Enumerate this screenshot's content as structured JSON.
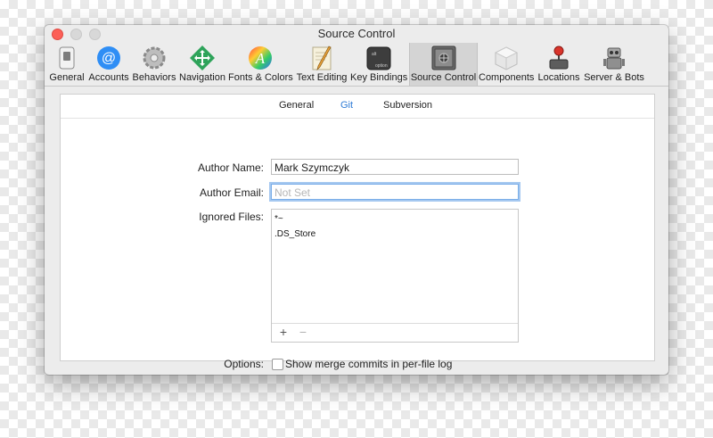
{
  "window": {
    "title": "Source Control"
  },
  "toolbar": {
    "items": [
      {
        "label": "General",
        "icon": "switch-icon"
      },
      {
        "label": "Accounts",
        "icon": "at-icon"
      },
      {
        "label": "Behaviors",
        "icon": "gear-icon"
      },
      {
        "label": "Navigation",
        "icon": "arrows-icon"
      },
      {
        "label": "Fonts & Colors",
        "icon": "font-color-icon"
      },
      {
        "label": "Text Editing",
        "icon": "pencil-paper-icon"
      },
      {
        "label": "Key Bindings",
        "icon": "keyboard-icon"
      },
      {
        "label": "Source Control",
        "icon": "safe-icon",
        "selected": true
      },
      {
        "label": "Components",
        "icon": "box-icon"
      },
      {
        "label": "Locations",
        "icon": "joystick-icon"
      },
      {
        "label": "Server & Bots",
        "icon": "robot-icon"
      }
    ]
  },
  "tabs": {
    "general": "General",
    "git": "Git",
    "subversion": "Subversion",
    "active": "Git"
  },
  "form": {
    "author_name_label": "Author Name:",
    "author_name_value": "Mark Szymczyk",
    "author_email_label": "Author Email:",
    "author_email_placeholder": "Not Set",
    "ignored_files_label": "Ignored Files:",
    "ignored_files": [
      "*~",
      ".DS_Store"
    ],
    "add_symbol": "+",
    "remove_symbol": "−",
    "options_label": "Options:",
    "merge_commits_label": "Show merge commits in per-file log",
    "merge_commits_checked": false
  },
  "colors": {
    "accent": "#2e7bd6",
    "close": "#fc5f57",
    "focus_ring": "#a5c8f0"
  }
}
